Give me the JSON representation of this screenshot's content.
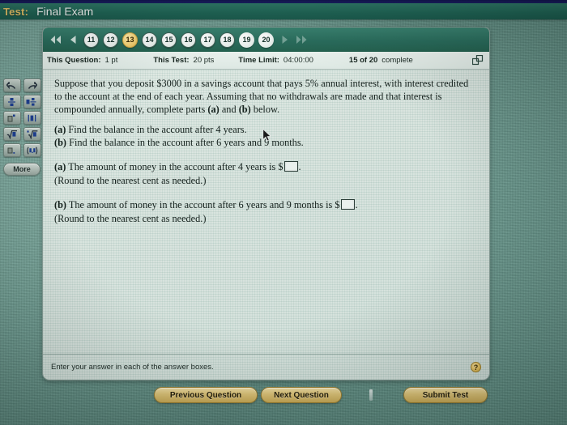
{
  "titlebar": {
    "label": "Test:",
    "test_name": "Final Exam"
  },
  "palette": {
    "more_label": "More",
    "buttons": [
      {
        "name": "undo-icon",
        "tip": "Undo"
      },
      {
        "name": "redo-icon",
        "tip": "Redo"
      },
      {
        "name": "fraction-icon",
        "tip": "Fraction"
      },
      {
        "name": "mixed-number-icon",
        "tip": "Mixed number"
      },
      {
        "name": "exponent-icon",
        "tip": "Exponent"
      },
      {
        "name": "absolute-value-icon",
        "tip": "Absolute value"
      },
      {
        "name": "square-root-icon",
        "tip": "Square root"
      },
      {
        "name": "nth-root-icon",
        "tip": "Nth root"
      },
      {
        "name": "decimal-icon",
        "tip": "Decimal"
      },
      {
        "name": "interval-icon",
        "tip": "Interval"
      }
    ]
  },
  "nav": {
    "first_label": "◀◀",
    "prev_label": "◀",
    "next_label": "▶",
    "last_label": "▶▶",
    "questions": [
      {
        "number": "11",
        "state": "answered"
      },
      {
        "number": "12",
        "state": "answered"
      },
      {
        "number": "13",
        "state": "current"
      },
      {
        "number": "14",
        "state": "answered"
      },
      {
        "number": "15",
        "state": "answered"
      },
      {
        "number": "16",
        "state": "answered"
      },
      {
        "number": "17",
        "state": "answered"
      },
      {
        "number": "18",
        "state": "answered"
      },
      {
        "number": "19",
        "state": "unanswered"
      },
      {
        "number": "20",
        "state": "unanswered"
      }
    ]
  },
  "status": {
    "this_question_label": "This Question:",
    "this_question_value": "1 pt",
    "this_test_label": "This Test:",
    "this_test_value": "20 pts",
    "time_limit_label": "Time Limit:",
    "time_limit_value": "04:00:00",
    "progress_count": "15 of 20",
    "progress_word": "complete"
  },
  "question": {
    "stem": "Suppose that you deposit $3000 in a savings account that pays 5% annual interest, with interest credited to the account at the end of each year. Assuming that no withdrawals are made and that interest is compounded annually, complete parts",
    "stem_tail": "below.",
    "stem_a": "(a)",
    "stem_and": "and",
    "stem_b": "(b)",
    "part_a_label": "(a)",
    "part_a_prompt": "Find the balance in the account after 4 years.",
    "part_b_label": "(b)",
    "part_b_prompt": "Find the balance in the account after 6 years and 9 months.",
    "answer_a_label": "(a)",
    "answer_a_text": "The amount of money in the account after 4 years is $",
    "answer_a_value": "",
    "answer_a_period": ".",
    "answer_a_round": "(Round to the nearest cent as needed.)",
    "answer_b_label": "(b)",
    "answer_b_text": "The amount of money in the account after 6 years and 9 months is $",
    "answer_b_value": "",
    "answer_b_period": ".",
    "answer_b_round": "(Round to the nearest cent as needed.)"
  },
  "footer": {
    "hint": "Enter your answer in each of the answer boxes.",
    "help_glyph": "?"
  },
  "actions": {
    "previous_label": "Previous Question",
    "next_label": "Next Question",
    "submit_label": "Submit Test"
  },
  "colors": {
    "title_accent": "#e3c268",
    "titlebar_green": "#1f6354",
    "nav_strip_green": "#2a6d5d",
    "current_pill_gold": "#f2cf72",
    "action_button_gold": "#ddc478",
    "screen_teal": "#6fa296"
  }
}
